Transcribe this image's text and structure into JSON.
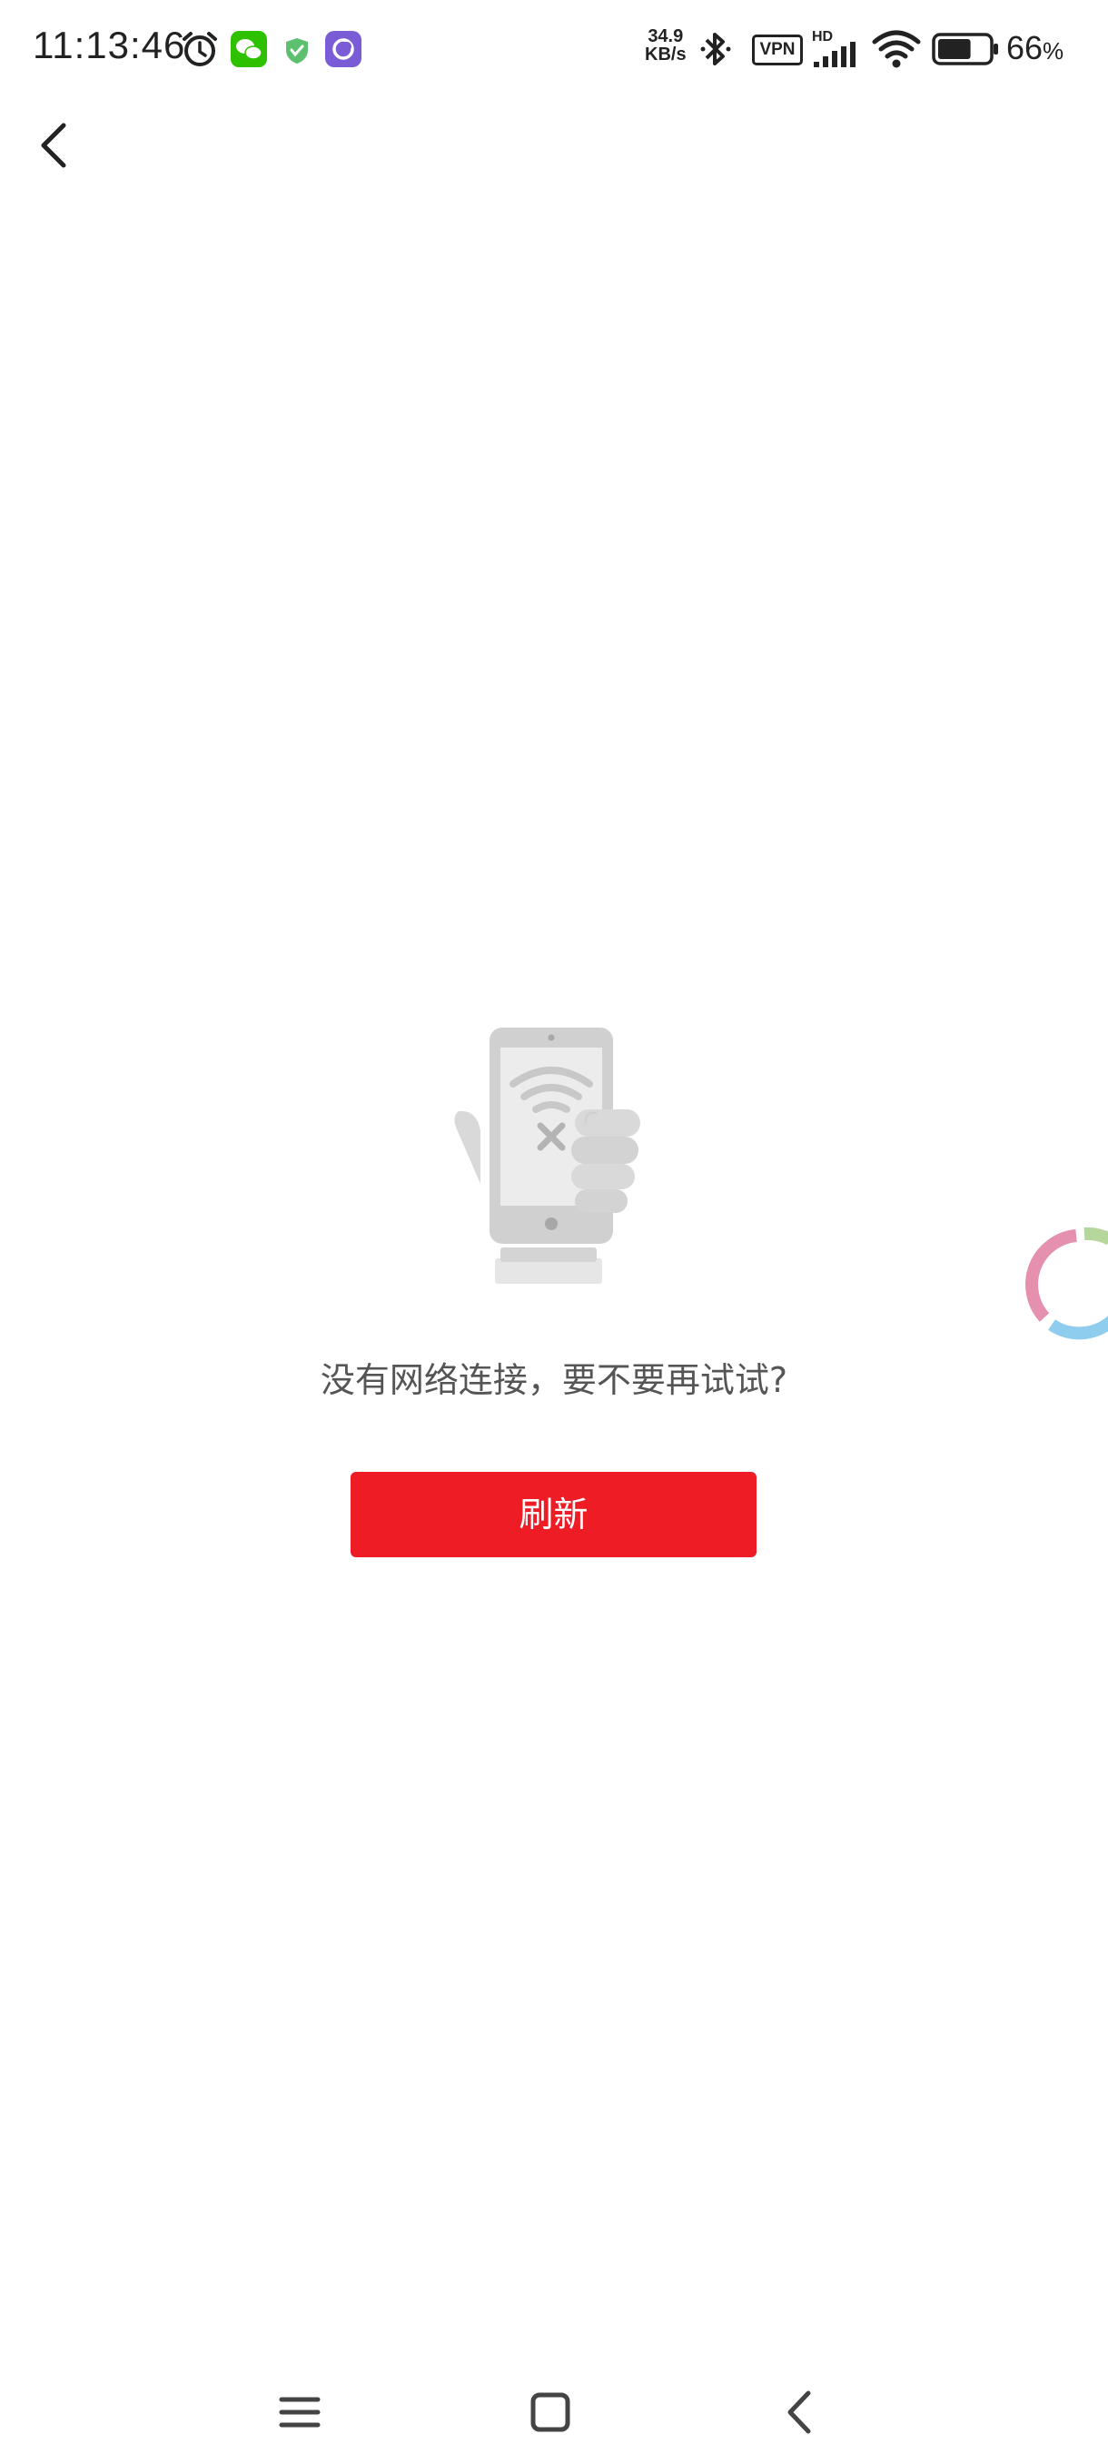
{
  "status_bar": {
    "time": "11:13:46",
    "net_speed_value": "34.9",
    "net_speed_unit": "KB/s",
    "hd_label": "HD",
    "vpn_label": "VPN",
    "battery_percent": "66",
    "battery_unit": "%",
    "battery_level": 0.66,
    "icons": [
      "alarm-icon",
      "wechat-icon",
      "shield-icon",
      "app-moon-icon",
      "bluetooth-icon",
      "signal-icon",
      "wifi-icon",
      "battery-icon"
    ]
  },
  "header": {
    "back_icon": "back-arrow-icon"
  },
  "empty_state": {
    "illustration": "no-network-phone-illustration",
    "message": "没有网络连接，要不要再试试?",
    "refresh_label": "刷新",
    "refresh_color": "#ee1c25"
  },
  "floating": {
    "icon": "loading-spinner-icon"
  },
  "nav_bar": {
    "buttons": [
      "menu-icon",
      "home-icon",
      "back-icon"
    ]
  }
}
